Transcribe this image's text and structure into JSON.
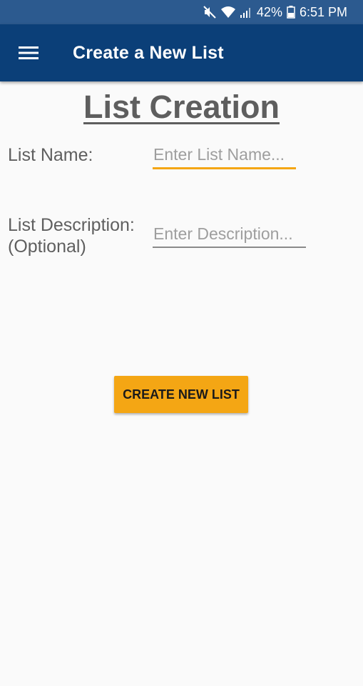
{
  "status_bar": {
    "battery_percent": "42%",
    "time": "6:51 PM",
    "icons": [
      "mute-icon",
      "wifi-icon",
      "signal-icon",
      "battery-icon"
    ]
  },
  "app_bar": {
    "title": "Create a New List",
    "menu_icon": "hamburger-menu-icon"
  },
  "form": {
    "heading": "List Creation",
    "name_label": "List Name:",
    "name_placeholder": "Enter List Name...",
    "name_value": "",
    "description_label_line1": "List Description:",
    "description_label_line2": "(Optional)",
    "description_placeholder": "Enter Description...",
    "description_value": ""
  },
  "actions": {
    "create_button_label": "CREATE NEW LIST"
  },
  "colors": {
    "status_bar": "#2c5a8f",
    "app_bar": "#0b3f78",
    "accent": "#f4a614",
    "background": "#fafafa",
    "text": "#5f5f5f"
  }
}
